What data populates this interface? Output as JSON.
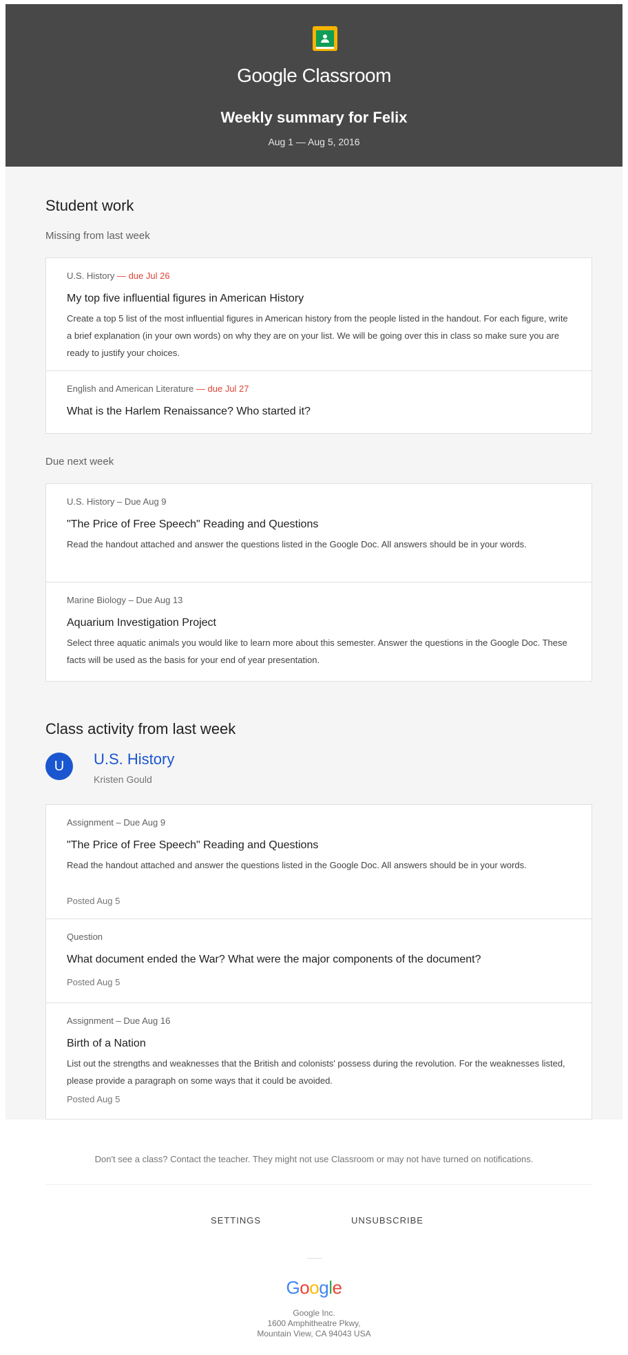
{
  "header": {
    "app_name": "Google Classroom",
    "summary_title": "Weekly summary for Felix",
    "date_range": "Aug 1 — Aug 5, 2016"
  },
  "student_work": {
    "title": "Student work",
    "missing": {
      "label": "Missing from last week",
      "items": [
        {
          "class": "U.S. History",
          "due": "due Jul 26",
          "title": "My top five influential figures in American History",
          "description": "Create a top 5 list of the most influential figures in American history from the people listed in the handout. For each figure, write a brief explanation (in your own words) on why they are on your list. We will be going over this in class so make sure you are ready to justify your choices."
        },
        {
          "class": "English and American Literature",
          "due": "due Jul 27",
          "title": "What is the Harlem Renaissance? Who started it?"
        }
      ]
    },
    "upcoming": {
      "label": "Due next week",
      "items": [
        {
          "class": "U.S. History",
          "due": "Due Aug 9",
          "title": "\"The Price of Free Speech\" Reading and Questions",
          "description": "Read the handout attached and answer the questions listed in the Google Doc. All answers should be in your words."
        },
        {
          "class": "Marine Biology",
          "due": "Due Aug 13",
          "title": "Aquarium Investigation Project",
          "description": "Select three aquatic animals you would like to learn more about this semester. Answer the questions in the Google Doc. These facts will be used as the basis for your end of year presentation."
        }
      ]
    }
  },
  "class_activity": {
    "title": "Class activity from last week",
    "class": {
      "initial": "U",
      "name": "U.S. History",
      "teacher": "Kristen Gould",
      "color": "#1a56cf"
    },
    "items": [
      {
        "type": "Assignment",
        "due": "Due Aug 9",
        "title": "\"The Price of Free Speech\" Reading and Questions",
        "description": "Read the handout attached and answer the questions listed in the Google Doc. All answers should be in your words.",
        "posted": "Posted Aug 5"
      },
      {
        "type": "Question",
        "title": "What document ended the War? What were the major components of the document?",
        "posted": "Posted Aug 5"
      },
      {
        "type": "Assignment",
        "due": "Due Aug 16",
        "title": "Birth of a Nation",
        "description": "List out the strengths and weaknesses that the British and colonists' possess during the revolution. For the weaknesses listed, please provide a paragraph on some ways that it could be avoided.",
        "posted": "Posted Aug 5"
      }
    ]
  },
  "footer": {
    "note": "Don't see a class? Contact the teacher. They might not use Classroom or may not have turned on notifications.",
    "settings": "SETTINGS",
    "unsubscribe": "UNSUBSCRIBE",
    "logo_letters": [
      "G",
      "o",
      "o",
      "g",
      "l",
      "e"
    ],
    "address": [
      "Google Inc.",
      "1600 Amphitheatre Pkwy,",
      "Mountain View, CA 94043 USA"
    ]
  },
  "separator": " — ",
  "separator_short": " – "
}
